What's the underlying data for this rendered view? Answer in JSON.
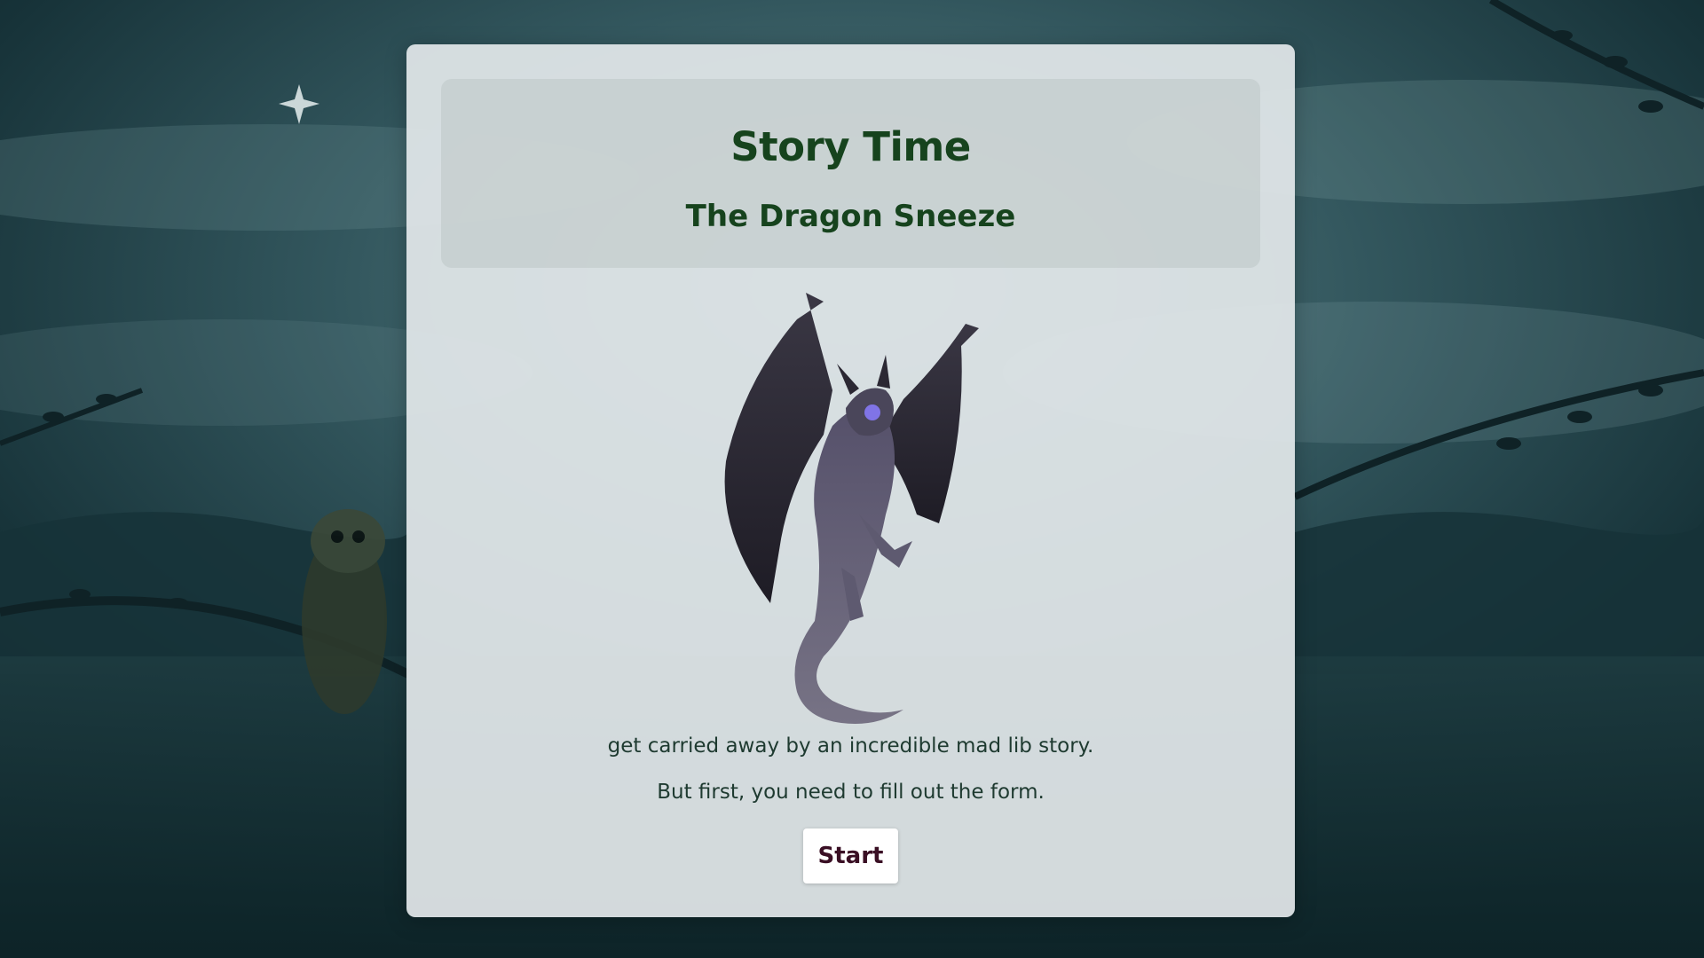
{
  "header": {
    "title": "Story Time",
    "subtitle": "The Dragon Sneeze"
  },
  "main": {
    "intro_line": "get carried away by an incredible mad lib story.",
    "instruction_line": "But first, you need to fill out the form.",
    "start_label": "Start",
    "image_subject": "dragon-illustration"
  },
  "background": {
    "scene": "night forest with owl on branch",
    "sky_color": "#2c4d54",
    "title_color": "#16431d",
    "button_text_color": "#3a0f24"
  }
}
